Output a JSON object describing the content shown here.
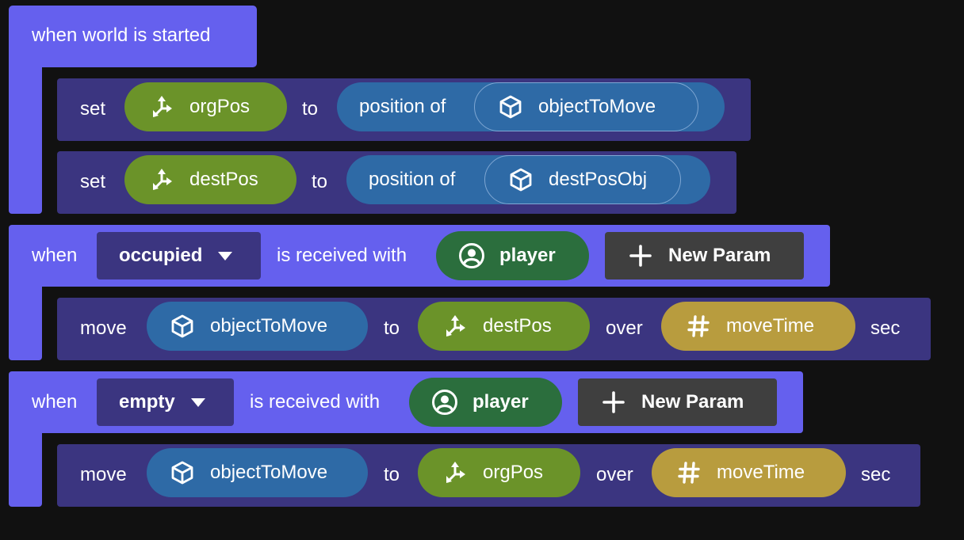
{
  "events": [
    {
      "label": "when world is started",
      "statements": [
        {
          "verb": "set",
          "variable": "orgPos",
          "connector": "to",
          "expression": "position of",
          "object": "objectToMove"
        },
        {
          "verb": "set",
          "variable": "destPos",
          "connector": "to",
          "expression": "position of",
          "object": "destPosObj"
        }
      ]
    },
    {
      "when": "when",
      "dropdown": "occupied",
      "middle": "is received with",
      "param": "player",
      "new_param": "New Param",
      "statement": {
        "verb": "move",
        "object": "objectToMove",
        "to_label": "to",
        "target": "destPos",
        "over_label": "over",
        "duration": "moveTime",
        "unit": "sec"
      }
    },
    {
      "when": "when",
      "dropdown": "empty",
      "middle": "is received with",
      "param": "player",
      "new_param": "New Param",
      "statement": {
        "verb": "move",
        "object": "objectToMove",
        "to_label": "to",
        "target": "orgPos",
        "over_label": "over",
        "duration": "moveTime",
        "unit": "sec"
      }
    }
  ],
  "icons": {
    "vector": "vector-axes-icon",
    "object": "cube-icon",
    "number": "hash-icon",
    "player": "player-avatar-icon",
    "add": "plus-icon",
    "dropdown": "caret-down-icon"
  },
  "colors": {
    "background": "#111111",
    "event_block": "#6560ee",
    "statement_block": "#3b3580",
    "vector_pill": "#6b9329",
    "object_pill": "#2e6aa6",
    "number_pill": "#b89c3e",
    "player_pill": "#2b6e3d",
    "new_param_button": "#3f3f3f"
  }
}
